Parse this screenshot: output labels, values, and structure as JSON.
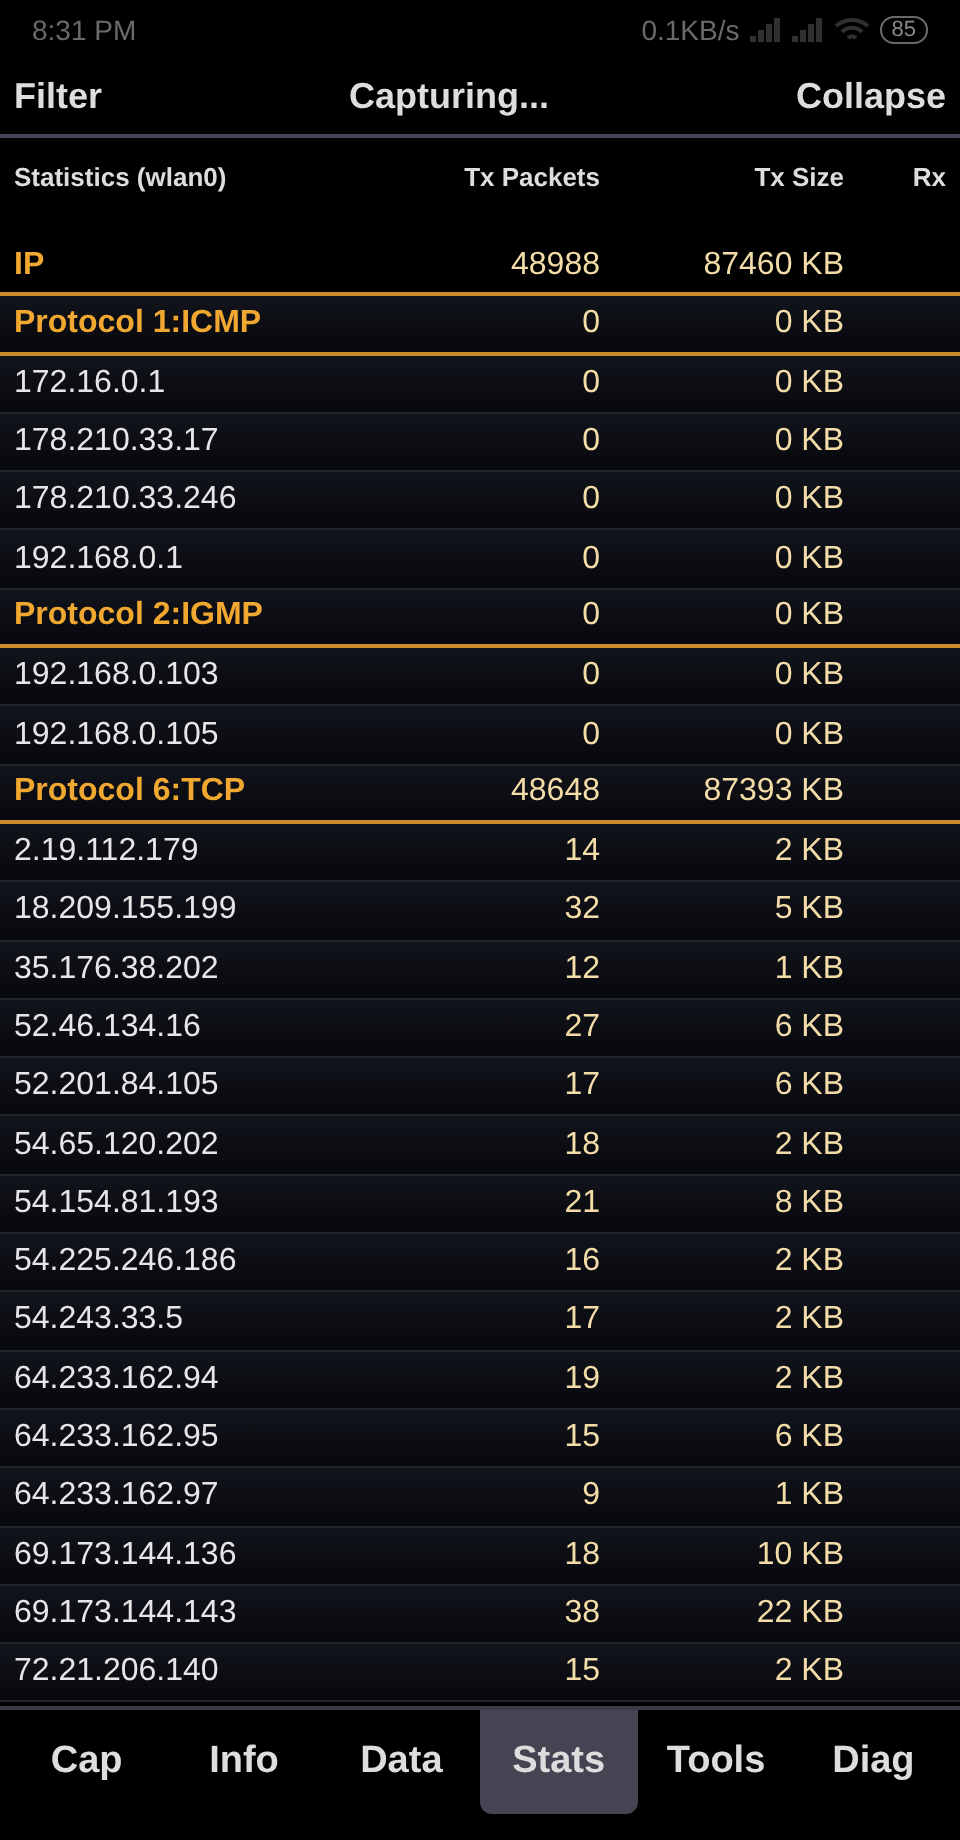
{
  "status_bar": {
    "time": "8:31 PM",
    "speed": "0.1KB/s",
    "battery": "85"
  },
  "toolbar": {
    "left": "Filter",
    "title": "Capturing...",
    "right": "Collapse"
  },
  "table": {
    "columns": [
      "Statistics (wlan0)",
      "Tx Packets",
      "Tx Size",
      "Rx"
    ],
    "rows": [
      {
        "kind": "total",
        "name": "IP",
        "packets": "48988",
        "size": "87460 KB"
      },
      {
        "kind": "protocol",
        "name": "Protocol 1:ICMP",
        "packets": "0",
        "size": "0 KB"
      },
      {
        "kind": "host",
        "name": "172.16.0.1",
        "packets": "0",
        "size": "0 KB"
      },
      {
        "kind": "host",
        "name": "178.210.33.17",
        "packets": "0",
        "size": "0 KB"
      },
      {
        "kind": "host",
        "name": "178.210.33.246",
        "packets": "0",
        "size": "0 KB"
      },
      {
        "kind": "host",
        "name": "192.168.0.1",
        "packets": "0",
        "size": "0 KB"
      },
      {
        "kind": "protocol",
        "name": "Protocol 2:IGMP",
        "packets": "0",
        "size": "0 KB"
      },
      {
        "kind": "host",
        "name": "192.168.0.103",
        "packets": "0",
        "size": "0 KB"
      },
      {
        "kind": "host",
        "name": "192.168.0.105",
        "packets": "0",
        "size": "0 KB"
      },
      {
        "kind": "protocol",
        "name": "Protocol 6:TCP",
        "packets": "48648",
        "size": "87393 KB"
      },
      {
        "kind": "host",
        "name": "2.19.112.179",
        "packets": "14",
        "size": "2 KB"
      },
      {
        "kind": "host",
        "name": "18.209.155.199",
        "packets": "32",
        "size": "5 KB"
      },
      {
        "kind": "host",
        "name": "35.176.38.202",
        "packets": "12",
        "size": "1 KB"
      },
      {
        "kind": "host",
        "name": "52.46.134.16",
        "packets": "27",
        "size": "6 KB"
      },
      {
        "kind": "host",
        "name": "52.201.84.105",
        "packets": "17",
        "size": "6 KB"
      },
      {
        "kind": "host",
        "name": "54.65.120.202",
        "packets": "18",
        "size": "2 KB"
      },
      {
        "kind": "host",
        "name": "54.154.81.193",
        "packets": "21",
        "size": "8 KB"
      },
      {
        "kind": "host",
        "name": "54.225.246.186",
        "packets": "16",
        "size": "2 KB"
      },
      {
        "kind": "host",
        "name": "54.243.33.5",
        "packets": "17",
        "size": "2 KB"
      },
      {
        "kind": "host",
        "name": "64.233.162.94",
        "packets": "19",
        "size": "2 KB"
      },
      {
        "kind": "host",
        "name": "64.233.162.95",
        "packets": "15",
        "size": "6 KB"
      },
      {
        "kind": "host",
        "name": "64.233.162.97",
        "packets": "9",
        "size": "1 KB"
      },
      {
        "kind": "host",
        "name": "69.173.144.136",
        "packets": "18",
        "size": "10 KB"
      },
      {
        "kind": "host",
        "name": "69.173.144.143",
        "packets": "38",
        "size": "22 KB"
      },
      {
        "kind": "host",
        "name": "72.21.206.140",
        "packets": "15",
        "size": "2 KB"
      }
    ]
  },
  "tabs": [
    {
      "label": "Cap",
      "selected": false
    },
    {
      "label": "Info",
      "selected": false
    },
    {
      "label": "Data",
      "selected": false
    },
    {
      "label": "Stats",
      "selected": true
    },
    {
      "label": "Tools",
      "selected": false
    },
    {
      "label": "Diag",
      "selected": false
    }
  ]
}
